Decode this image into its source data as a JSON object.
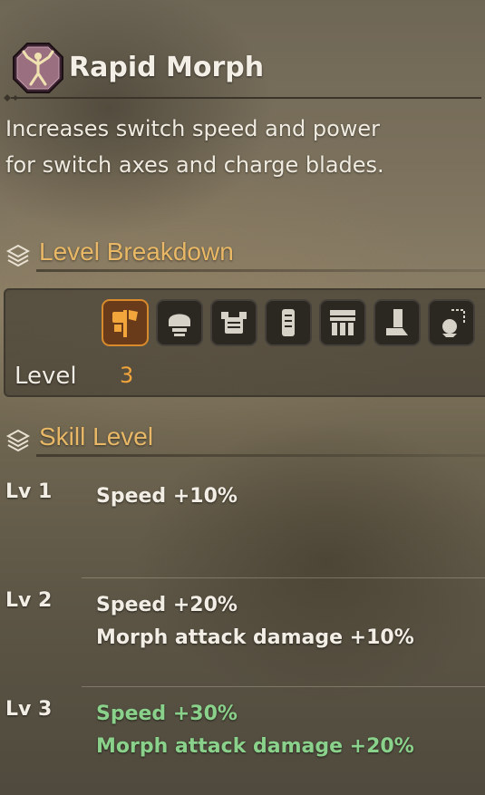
{
  "skill": {
    "name": "Rapid Morph",
    "icon": "skill-emblem-icon",
    "description_lines": [
      "Increases switch speed and power",
      "for switch axes and charge blades."
    ]
  },
  "breakdown": {
    "heading": "Level Breakdown",
    "equipment_slots": [
      {
        "icon": "weapon-slot-icon",
        "active": true
      },
      {
        "icon": "helm-slot-icon",
        "active": false
      },
      {
        "icon": "chest-slot-icon",
        "active": false
      },
      {
        "icon": "arms-slot-icon",
        "active": false
      },
      {
        "icon": "waist-slot-icon",
        "active": false
      },
      {
        "icon": "legs-slot-icon",
        "active": false
      },
      {
        "icon": "talisman-slot-icon",
        "active": false
      }
    ],
    "level_label": "Level",
    "level_value": "3"
  },
  "skill_levels": {
    "heading": "Skill Level",
    "levels": [
      {
        "label": "Lv 1",
        "effects": [
          "Speed +10%"
        ],
        "current": false
      },
      {
        "label": "Lv 2",
        "effects": [
          "Speed +20%",
          "Morph attack damage +10%"
        ],
        "current": false
      },
      {
        "label": "Lv 3",
        "effects": [
          "Speed +30%",
          "Morph attack damage +20%"
        ],
        "current": true
      }
    ]
  },
  "colors": {
    "accent_gold": "#e9b866",
    "level_orange": "#f2a53a",
    "current_green": "#8ad28b",
    "active_slot": "#d88b2c"
  }
}
